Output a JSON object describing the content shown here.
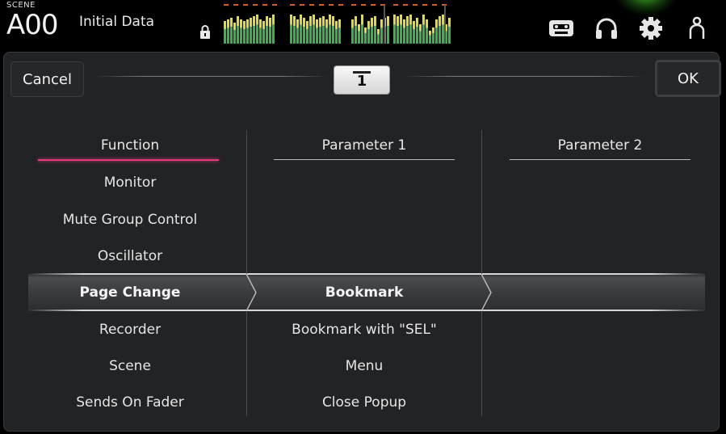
{
  "header": {
    "scene_label": "SCENE",
    "scene_number": "A00",
    "scene_title": "Initial Data",
    "icons": [
      "lock-icon",
      "recorder-icon",
      "headphones-icon",
      "settings-gear-icon",
      "user-icon"
    ]
  },
  "dialog": {
    "cancel_label": "Cancel",
    "ok_label": "OK",
    "key_number": "1"
  },
  "columns": {
    "function_header": "Function",
    "param1_header": "Parameter 1",
    "param2_header": "Parameter 2"
  },
  "function_list": [
    "Monitor",
    "Mute Group Control",
    "Oscillator",
    "Page Change",
    "Recorder",
    "Scene",
    "Sends On Fader"
  ],
  "selected_function": "Page Change",
  "param1_list": [
    "Bookmark",
    "Bookmark with \"SEL\"",
    "Menu",
    "Close Popup"
  ],
  "selected_param1": "Bookmark",
  "colors": {
    "accent_pink": "#e23a7a",
    "meter_green": "#37b44a",
    "meter_yellow": "#e9e22a",
    "meter_peak": "#e05b22"
  }
}
